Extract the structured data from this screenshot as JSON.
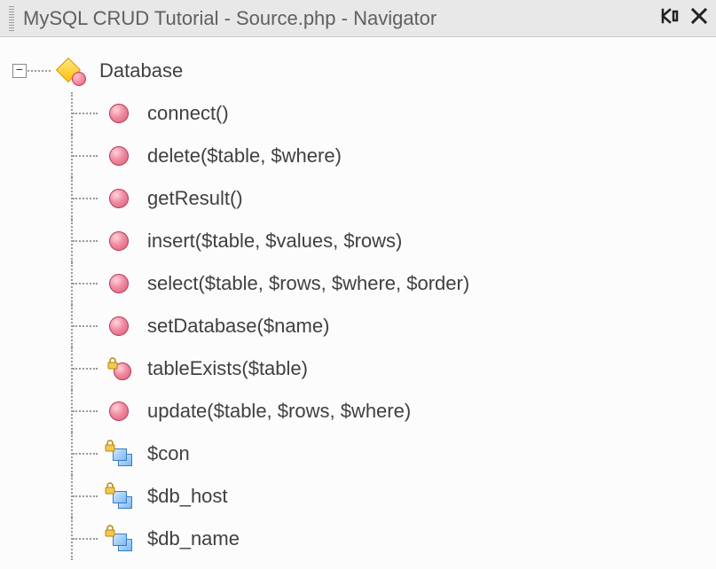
{
  "titlebar": {
    "title": "MySQL CRUD Tutorial - Source.php - Navigator"
  },
  "tree": {
    "root": {
      "label": "Database",
      "expanded": true
    },
    "children": [
      {
        "type": "method",
        "label": "connect()"
      },
      {
        "type": "method",
        "label": "delete($table, $where)"
      },
      {
        "type": "method",
        "label": "getResult()"
      },
      {
        "type": "method",
        "label": "insert($table, $values, $rows)"
      },
      {
        "type": "method",
        "label": "select($table, $rows, $where, $order)"
      },
      {
        "type": "method",
        "label": "setDatabase($name)"
      },
      {
        "type": "privateMethod",
        "label": "tableExists($table)"
      },
      {
        "type": "method",
        "label": "update($table, $rows, $where)"
      },
      {
        "type": "privateProp",
        "label": "$con"
      },
      {
        "type": "privateProp",
        "label": "$db_host"
      },
      {
        "type": "privateProp",
        "label": "$db_name"
      }
    ]
  }
}
